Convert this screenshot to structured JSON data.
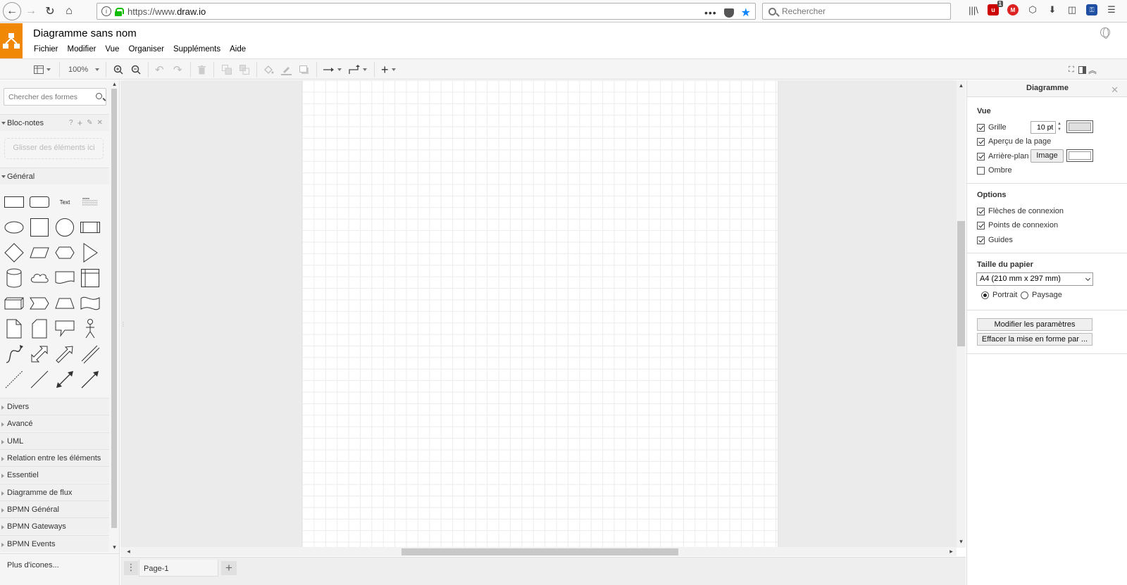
{
  "browser": {
    "url_prefix": "https://www.",
    "url_domain": "draw.io",
    "search_placeholder": "Rechercher",
    "ublock_badge": "1"
  },
  "app": {
    "title": "Diagramme sans nom",
    "menu": [
      "Fichier",
      "Modifier",
      "Vue",
      "Organiser",
      "Suppléments",
      "Aide"
    ],
    "brand_color": "#f08705"
  },
  "toolbar": {
    "zoom": "100%"
  },
  "left_panel": {
    "search_placeholder": "Chercher des formes",
    "scratchpad_title": "Bloc-notes",
    "scratchpad_actions": [
      "?",
      "+",
      "✎",
      "✕"
    ],
    "dropzone_text": "Glisser des éléments ici",
    "general_title": "Général",
    "text_shape_label": "Text",
    "collapsed_sections": [
      "Divers",
      "Avancé",
      "UML",
      "Relation entre les éléments",
      "Essentiel",
      "Diagramme de flux",
      "BPMN Général",
      "BPMN Gateways",
      "BPMN Events"
    ],
    "more_shapes": "Plus d'icones..."
  },
  "page_tab": {
    "name": "Page-1"
  },
  "right_panel": {
    "title": "Diagramme",
    "view_title": "Vue",
    "grid_label": "Grille",
    "grid_size": "10 pt",
    "page_view_label": "Aperçu de la page",
    "background_label": "Arrière-plan",
    "image_button": "Image",
    "shadow_label": "Ombre",
    "options_title": "Options",
    "connection_arrows": "Flèches de connexion",
    "connection_points": "Points de connexion",
    "guides": "Guides",
    "paper_title": "Taille du papier",
    "paper_size": "A4 (210 mm x 297 mm)",
    "portrait": "Portrait",
    "landscape": "Paysage",
    "edit_button": "Modifier les paramètres",
    "clear_button": "Effacer la mise en forme par ..."
  }
}
